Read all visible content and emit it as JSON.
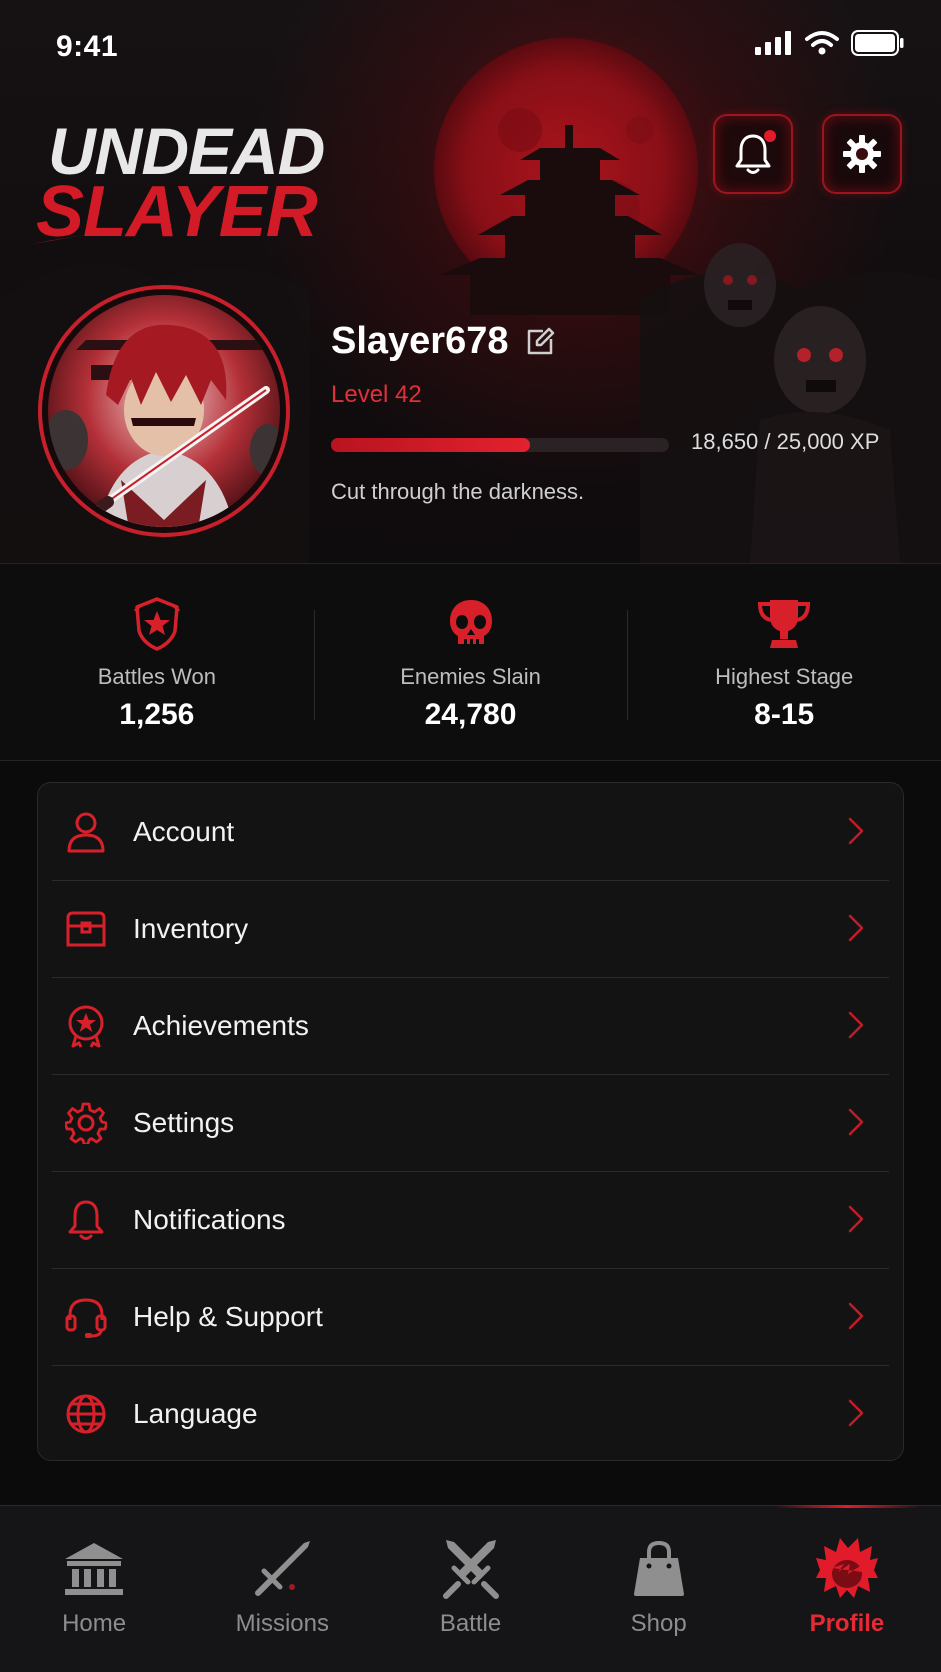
{
  "colors": {
    "accent": "#e21b2a",
    "background": "#0c0b0c",
    "panel": "#141314"
  },
  "status_bar": {
    "time": "9:41"
  },
  "logo": {
    "line1": "UNDEAD",
    "line2": "SLAYER"
  },
  "profile": {
    "username": "Slayer678",
    "level": "Level 42",
    "xp_text": "18,650 / 25,000 XP",
    "xp_progress": 0.59,
    "motto": "Cut through the darkness.",
    "notification_unread": true
  },
  "stats": [
    {
      "label": "Battles Won",
      "value": "1,256",
      "icon": "shield-star-icon"
    },
    {
      "label": "Enemies Slain",
      "value": "24,780",
      "icon": "skull-icon"
    },
    {
      "label": "Highest Stage",
      "value": "8-15",
      "icon": "trophy-icon"
    }
  ],
  "menu": [
    {
      "label": "Account",
      "icon": "user-icon"
    },
    {
      "label": "Inventory",
      "icon": "chest-icon"
    },
    {
      "label": "Achievements",
      "icon": "badge-icon"
    },
    {
      "label": "Settings",
      "icon": "gear-icon"
    },
    {
      "label": "Notifications",
      "icon": "bell-icon"
    },
    {
      "label": "Help & Support",
      "icon": "headset-icon"
    },
    {
      "label": "Language",
      "icon": "globe-icon"
    }
  ],
  "tabs": [
    {
      "label": "Home",
      "icon": "temple-icon",
      "active": false
    },
    {
      "label": "Missions",
      "icon": "sword-icon",
      "active": false
    },
    {
      "label": "Battle",
      "icon": "crossed-swords-icon",
      "active": false
    },
    {
      "label": "Shop",
      "icon": "bag-icon",
      "active": false
    },
    {
      "label": "Profile",
      "icon": "hero-head-icon",
      "active": true
    }
  ]
}
